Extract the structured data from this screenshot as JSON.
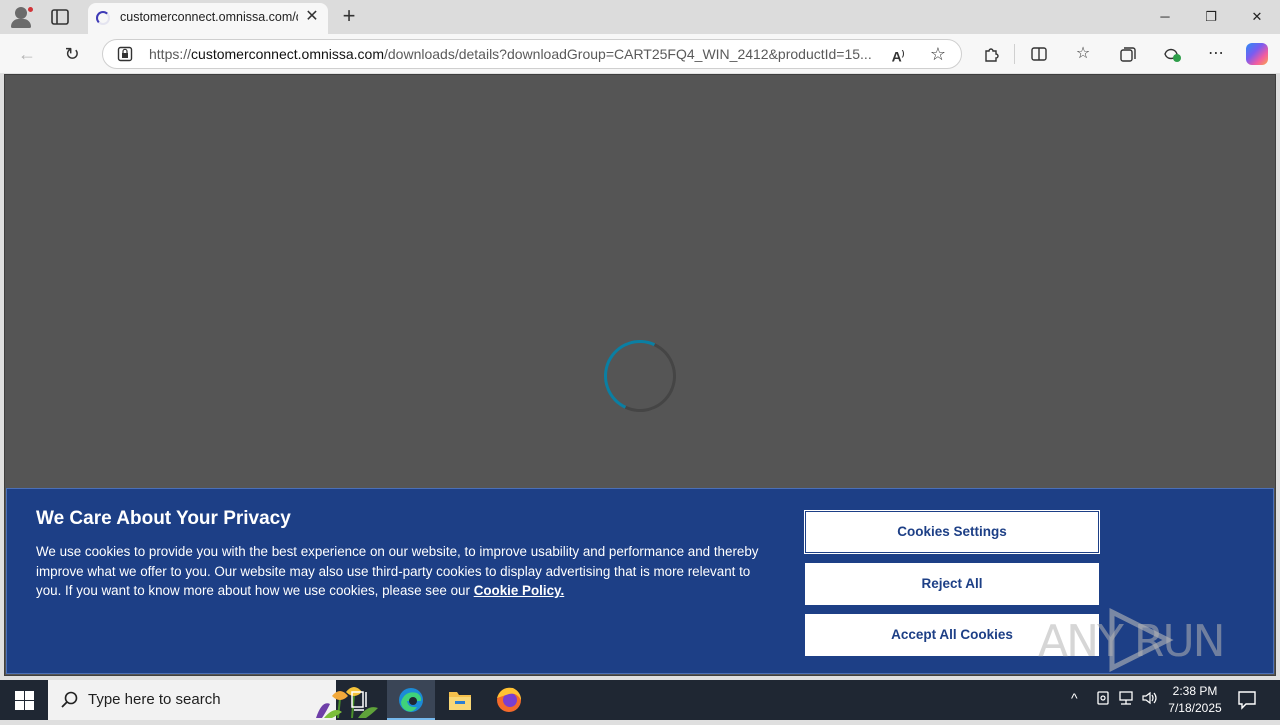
{
  "browser": {
    "tab_title": "customerconnect.omnissa.com/dc",
    "url_prefix": "https://",
    "url_host": "customerconnect.omnissa.com",
    "url_path": "/downloads/details?downloadGroup=CART25FQ4_WIN_2412&productId=15...",
    "window_controls": {
      "minimize": "─",
      "restore": "❐",
      "close": "✕"
    }
  },
  "cookie_banner": {
    "title": "We Care About Your Privacy",
    "body": "We use cookies to provide you with the best experience on our website, to improve usability and performance and thereby improve what we offer to you. Our website may also use third-party cookies to display advertising that is more relevant to you. If you want to know more about how we use cookies, please see our ",
    "policy_link": "Cookie Policy.",
    "settings_button": "Cookies Settings",
    "reject_button": "Reject All",
    "accept_button": "Accept All Cookies"
  },
  "watermark": {
    "text": "ANY RUN"
  },
  "taskbar": {
    "search_placeholder": "Type here to search",
    "time": "2:38 PM",
    "date": "7/18/2025"
  },
  "colors": {
    "banner_bg": "#1d3f86",
    "page_overlay": "#555555",
    "spinner_accent": "#0a7fa3",
    "taskbar_bg": "#1f2733"
  }
}
